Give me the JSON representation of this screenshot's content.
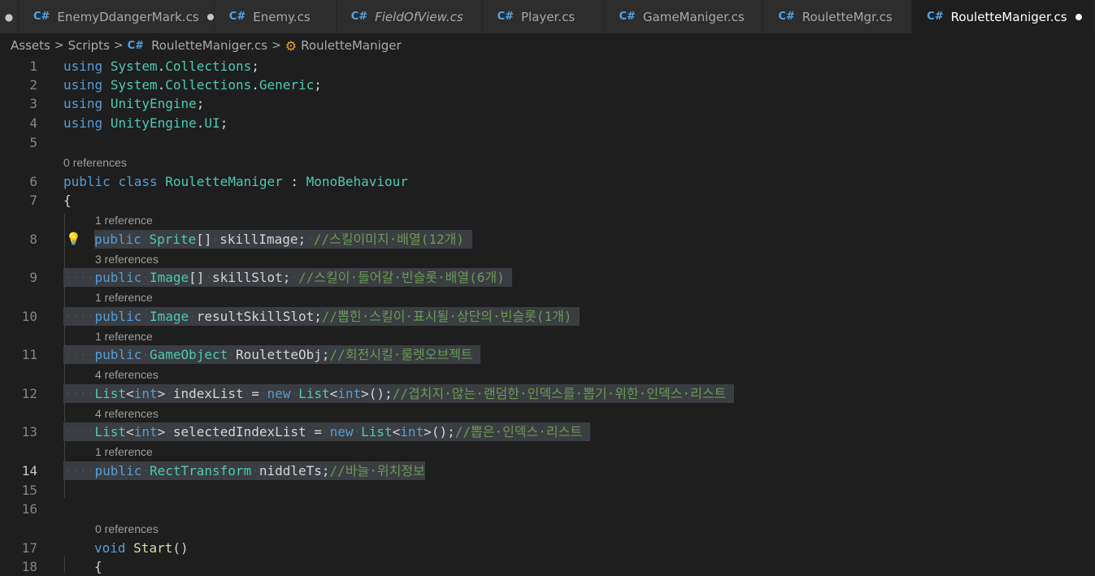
{
  "tabs": {
    "lead_glyph": "●",
    "items": [
      {
        "label": "EnemyDdangerMark.cs",
        "icon": "csharp-icon",
        "modified": true,
        "italic": false,
        "active": false
      },
      {
        "label": "Enemy.cs",
        "icon": "csharp-icon",
        "modified": false,
        "italic": false,
        "active": false
      },
      {
        "label": "FieldOfView.cs",
        "icon": "csharp-icon",
        "modified": false,
        "italic": true,
        "active": false
      },
      {
        "label": "Player.cs",
        "icon": "csharp-icon",
        "modified": false,
        "italic": false,
        "active": false
      },
      {
        "label": "GameManiger.cs",
        "icon": "csharp-icon",
        "modified": false,
        "italic": false,
        "active": false
      },
      {
        "label": "RouletteMgr.cs",
        "icon": "csharp-icon",
        "modified": false,
        "italic": false,
        "active": false
      },
      {
        "label": "RouletteManiger.cs",
        "icon": "csharp-icon",
        "modified": true,
        "italic": false,
        "active": true
      }
    ]
  },
  "breadcrumb": {
    "assets": "Assets",
    "scripts": "Scripts",
    "file": "RouletteManiger.cs",
    "symbol": "RouletteManiger",
    "separator": ">"
  },
  "editor": {
    "icon_glyph_cs": "C#",
    "lens": {
      "l6": "0 references",
      "l8": "1 reference",
      "l9": "3 references",
      "l10": "1 reference",
      "l11": "1 reference",
      "l12": "4 references",
      "l13": "4 references",
      "l14": "1 reference",
      "l17": "0 references"
    },
    "line_numbers": [
      "1",
      "2",
      "3",
      "4",
      "5",
      "6",
      "7",
      "8",
      "9",
      "10",
      "11",
      "12",
      "13",
      "14",
      "15",
      "16",
      "17",
      "18"
    ],
    "active_line": "14",
    "lines": {
      "l1": {
        "kw": "using",
        "ns1": "System",
        "dot": ".",
        "ns2": "Collections",
        "end": ";"
      },
      "l2": {
        "kw": "using",
        "ns1": "System",
        "dot1": ".",
        "ns2": "Collections",
        "dot2": ".",
        "ns3": "Generic",
        "end": ";"
      },
      "l3": {
        "kw": "using",
        "ns1": "UnityEngine",
        "end": ";"
      },
      "l4": {
        "kw": "using",
        "ns1": "UnityEngine",
        "dot": ".",
        "ns2": "UI",
        "end": ";"
      },
      "l6": {
        "kw1": "public",
        "kw2": "class",
        "name": "RouletteManiger",
        "colon": " : ",
        "base": "MonoBehaviour"
      },
      "l7": {
        "text": "{"
      },
      "l8": {
        "kw": "public",
        "type": "Sprite",
        "arr": "[]",
        "name": "skillImage",
        "end": ";",
        "comment": "//스킬이미지·배열(12개)"
      },
      "l9": {
        "ws": "····",
        "kw": "public",
        "type": "Image",
        "arr": "[]",
        "name": "skillSlot",
        "end": ";",
        "comment": "//스킬이·들어갈·빈슬롯·배열(6개)"
      },
      "l10": {
        "ws": "····",
        "kw": "public",
        "type": "Image",
        "name": "resultSkillSlot",
        "end": ";",
        "comment": "//뽑힌·스킬이·표시될·상단의·빈슬롯(1개)"
      },
      "l11": {
        "ws": "····",
        "kw": "public",
        "type": "GameObject",
        "name": "RouletteObj",
        "end": ";",
        "comment": "//회전시킬·룰렛오브젝트"
      },
      "l12": {
        "ws": "····",
        "type": "List",
        "lt": "<",
        "gtype": "int",
        "gt": ">",
        "name": "indexList",
        "eq": "=",
        "kw": "new",
        "type2": "List",
        "lt2": "<",
        "gtype2": "int",
        "gt2": ">",
        "call": "();",
        "comment": "//겹치지·않는·랜덤한·인덱스를·뽑기·위한·인덱스·리스트"
      },
      "l13": {
        "ws": "····",
        "type": "List",
        "lt": "<",
        "gtype": "int",
        "gt": ">",
        "name": "selectedIndexList",
        "eq": "=",
        "kw": "new",
        "type2": "List",
        "lt2": "<",
        "gtype2": "int",
        "gt2": ">",
        "call": "();",
        "comment": "//뽑은·인덱스·리스트"
      },
      "l14": {
        "ws": "····",
        "kw": "public",
        "type": "RectTransform",
        "name": "niddleTs",
        "end": ";",
        "comment": "//바늘·위치정보"
      },
      "l17": {
        "kw": "void",
        "fn": "Start",
        "paren": "()"
      },
      "l18": {
        "text": "{"
      }
    }
  },
  "colors": {
    "background": "#1e1e1e",
    "keyword": "#569cd6",
    "type": "#4ec9b0",
    "comment": "#6a9955",
    "selection": "#3a3d41",
    "tab_icon": "#4fa5e8",
    "lightbulb": "#ffcc00"
  }
}
